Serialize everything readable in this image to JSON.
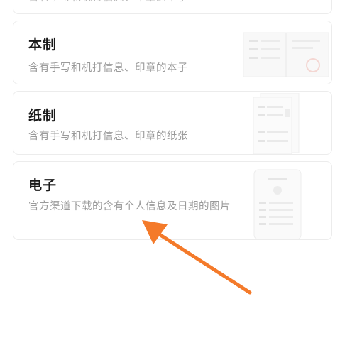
{
  "cards": [
    {
      "title": "",
      "description": "含有手写和机打信息、印章的本子",
      "thumbnail": "booklet-thumbnail"
    },
    {
      "title": "本制",
      "description": "含有手写和机打信息、印章的本子",
      "thumbnail": "booklet-thumbnail"
    },
    {
      "title": "纸制",
      "description": "含有手写和机打信息、印章的纸张",
      "thumbnail": "paper-form-thumbnail"
    },
    {
      "title": "电子",
      "description": "官方渠道下载的含有个人信息及日期的图片",
      "thumbnail": "phone-screen-thumbnail"
    }
  ],
  "annotation": {
    "arrow_color": "#f47a2a",
    "icon": "pointer-arrow"
  }
}
